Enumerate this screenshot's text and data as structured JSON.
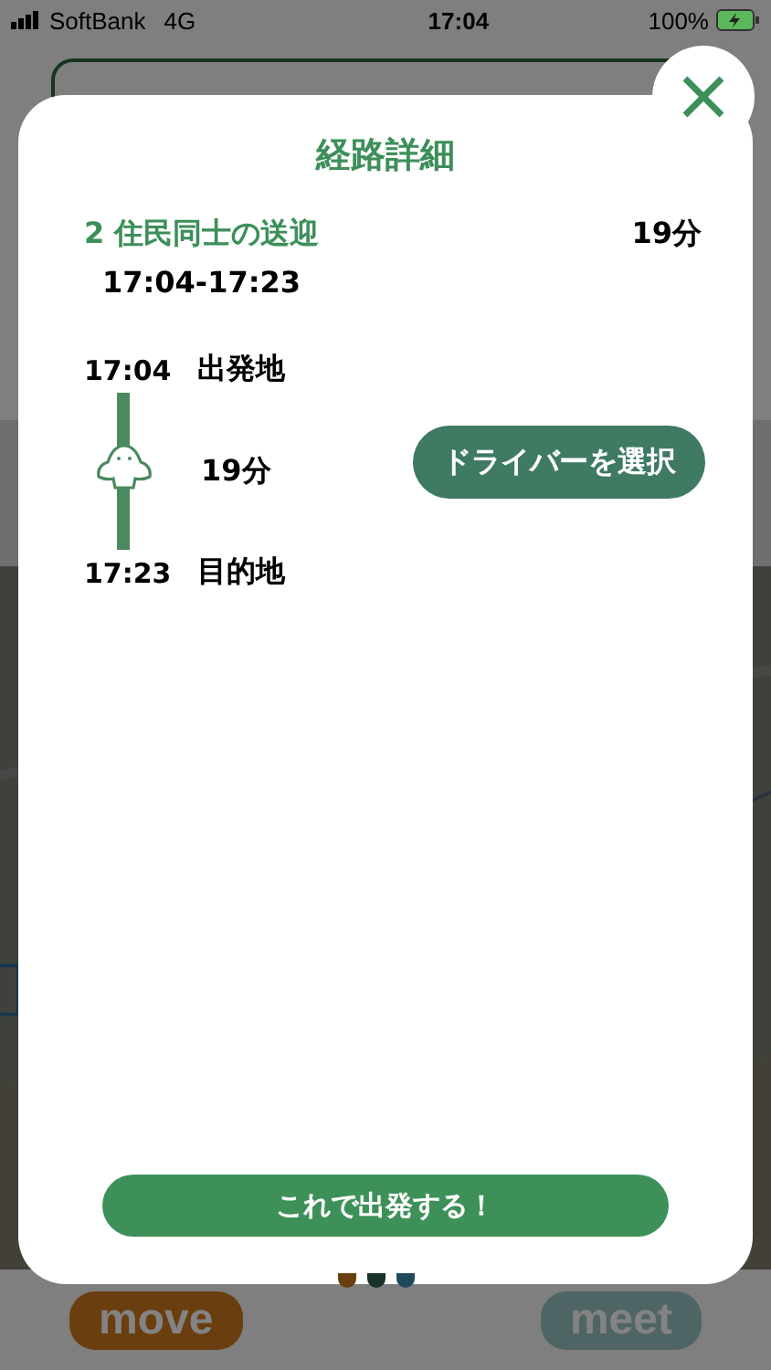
{
  "status_bar": {
    "carrier": "SoftBank",
    "network": "4G",
    "time": "17:04",
    "battery": "100%"
  },
  "background": {
    "bottom_buttons": [
      "move",
      "meet"
    ]
  },
  "modal": {
    "title": "経路詳細",
    "route": {
      "name": "2 住民同士の送迎",
      "duration": "19分",
      "time_range": "17:04-17:23"
    },
    "timeline": {
      "start_time": "17:04",
      "start_label": "出発地",
      "leg_duration": "19分",
      "end_time": "17:23",
      "end_label": "目的地"
    },
    "driver_button": "ドライバーを選択",
    "start_button": "これで出発する！"
  }
}
